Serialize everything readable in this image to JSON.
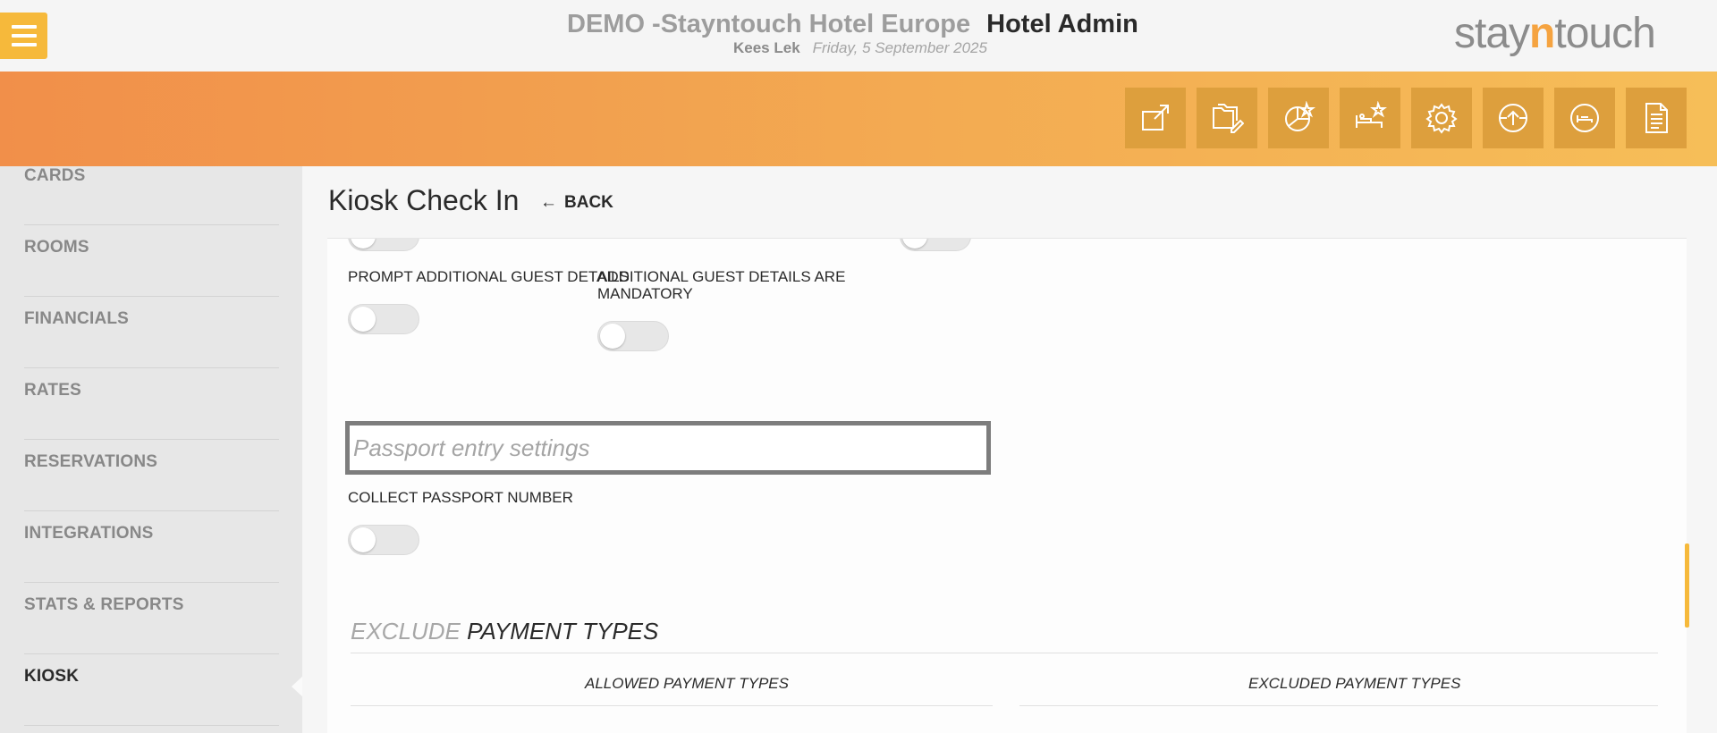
{
  "header": {
    "hotel_name": "DEMO -Stayntouch Hotel Europe",
    "app_name": "Hotel Admin",
    "user": "Kees Lek",
    "date": "Friday, 5 September 2025",
    "logo": {
      "part1": "stay",
      "part2": "n",
      "part3": "touch"
    },
    "accent_color": "#f6b93b"
  },
  "toolbar": {
    "icons": [
      "external-link-icon",
      "folders-edit-icon",
      "chart-star-icon",
      "bed-star-icon",
      "gear-icon",
      "upload-circle-icon",
      "bed-circle-icon",
      "document-icon"
    ]
  },
  "sidebar": {
    "items": [
      {
        "label": "CARDS"
      },
      {
        "label": "ROOMS"
      },
      {
        "label": "FINANCIALS"
      },
      {
        "label": "RATES"
      },
      {
        "label": "RESERVATIONS"
      },
      {
        "label": "INTEGRATIONS"
      },
      {
        "label": "STATS & REPORTS"
      },
      {
        "label": "KIOSK",
        "active": true
      }
    ]
  },
  "page": {
    "title": "Kiosk Check In",
    "back_label": "BACK"
  },
  "settings": {
    "prompt_additional_guest": "PROMPT ADDITIONAL GUEST DETAILS",
    "additional_guest_mandatory": "ADDITIONAL GUEST DETAILS ARE MANDATORY",
    "passport_placeholder": "Passport entry settings",
    "collect_passport": "COLLECT PASSPORT NUMBER"
  },
  "payment": {
    "title_muted": "EXCLUDE",
    "title_dark": "PAYMENT TYPES",
    "allowed_header": "ALLOWED PAYMENT TYPES",
    "excluded_header": "EXCLUDED PAYMENT TYPES"
  }
}
